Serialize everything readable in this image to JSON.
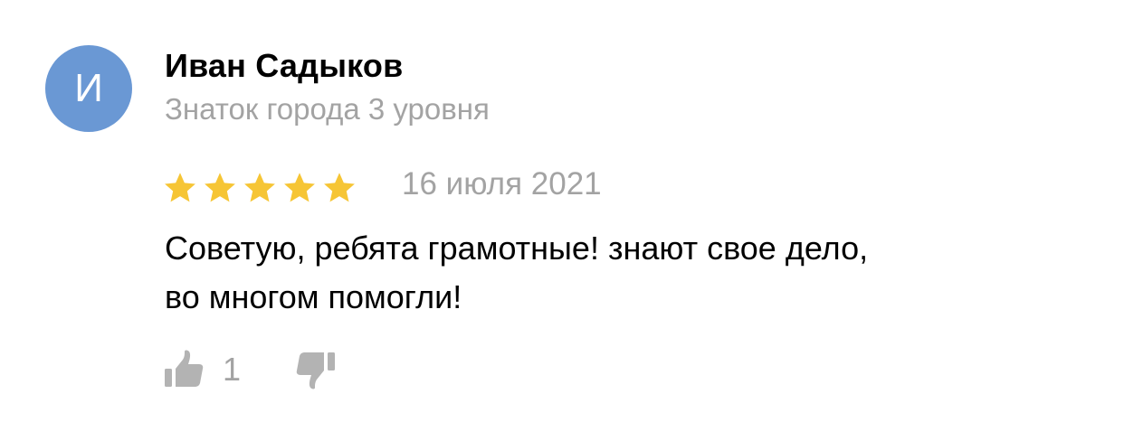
{
  "review": {
    "avatar_letter": "И",
    "avatar_color": "#6a98d4",
    "author_name": "Иван Садыков",
    "author_level": "Знаток города 3 уровня",
    "rating": 5,
    "rating_max": 5,
    "star_color": "#f6c535",
    "date": "16 июля 2021",
    "text_line_1": "Советую, ребята грамотные! знают свое дело,",
    "text_line_2": "во многом помогли!",
    "likes": "1",
    "like_icon": "thumbs-up-icon",
    "dislike_icon": "thumbs-down-icon"
  }
}
